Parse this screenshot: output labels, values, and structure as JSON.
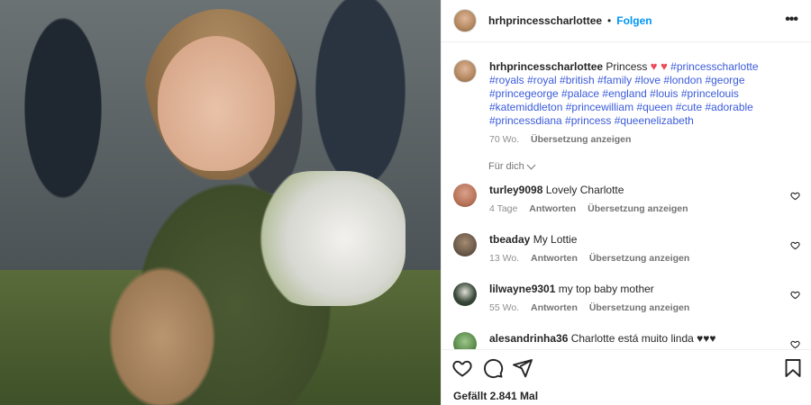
{
  "post": {
    "username": "hrhprincesscharlottee",
    "follow_label": "Folgen",
    "separator": "•",
    "more_label": "•••"
  },
  "caption": {
    "username": "hrhprincesscharlottee",
    "text": "Princess",
    "hearts": "♥ ♥",
    "hashtags": "#princesscharlotte #royals #royal #british #family #love #london #george #princegeorge #palace #england #louis #princelouis #katemiddleton #princewilliam #queen #cute #adorable #princessdiana #princess #queenelizabeth",
    "time": "70 Wo.",
    "translate": "Übersetzung anzeigen"
  },
  "for_you": "Für dich",
  "comments": [
    {
      "username": "turley9098",
      "text": "Lovely Charlotte",
      "time": "4 Tage",
      "reply": "Antworten",
      "translate": "Übersetzung anzeigen",
      "avatar_color": "#b8745a"
    },
    {
      "username": "tbeaday",
      "text": "My Lottie",
      "time": "13 Wo.",
      "reply": "Antworten",
      "translate": "Übersetzung anzeigen",
      "avatar_color": "#6b5a4a"
    },
    {
      "username": "lilwayne9301",
      "text": "my top baby mother",
      "time": "55 Wo.",
      "reply": "Antworten",
      "translate": "Übersetzung anzeigen",
      "avatar_color": "#3a4a3a"
    },
    {
      "username": "alesandrinha36",
      "text": "Charlotte está muito linda ♥♥♥",
      "time": "",
      "reply": "",
      "translate": "",
      "avatar_color": "#5a8a4a"
    }
  ],
  "actions": {
    "likes": "Gefällt 2.841 Mal",
    "icons": [
      "heart-icon",
      "comment-icon",
      "share-icon",
      "bookmark-icon"
    ]
  },
  "colors": {
    "link": "#0095f6",
    "hashtag": "#3b5bdb",
    "heart": "#ed4956",
    "muted": "#8e8e8e"
  }
}
